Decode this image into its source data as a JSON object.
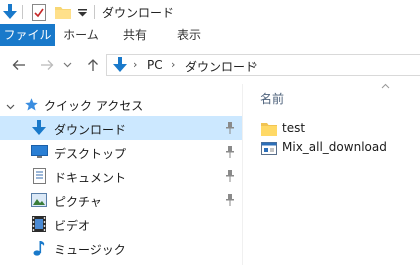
{
  "window": {
    "title": "ダウンロード"
  },
  "quick_access_toolbar": {
    "icons": [
      "download-arrow-icon",
      "properties-icon",
      "folder-icon",
      "customize-dropdown-icon"
    ]
  },
  "ribbon": {
    "tabs": [
      {
        "label": "ファイル",
        "active": true
      },
      {
        "label": "ホーム"
      },
      {
        "label": "共有"
      },
      {
        "label": "表示"
      }
    ],
    "accent": "#1979ca"
  },
  "address_bar": {
    "breadcrumbs": [
      "PC",
      "ダウンロード"
    ]
  },
  "navigation_pane": {
    "items": [
      {
        "label": "クイック アクセス",
        "icon": "star-icon",
        "expanded": true
      },
      {
        "label": "ダウンロード",
        "icon": "download-icon",
        "pinned": true,
        "selected": true
      },
      {
        "label": "デスクトップ",
        "icon": "desktop-icon",
        "pinned": true
      },
      {
        "label": "ドキュメント",
        "icon": "document-icon",
        "pinned": true
      },
      {
        "label": "ピクチャ",
        "icon": "picture-icon",
        "pinned": true
      },
      {
        "label": "ビデオ",
        "icon": "video-icon"
      },
      {
        "label": "ミュージック",
        "icon": "music-icon"
      }
    ],
    "selected_color": "#cce8ff"
  },
  "file_list": {
    "column_header": "名前",
    "files": [
      {
        "name": "test",
        "icon": "folder-icon"
      },
      {
        "name": "Mix_all_download",
        "icon": "app-file-icon"
      }
    ]
  }
}
